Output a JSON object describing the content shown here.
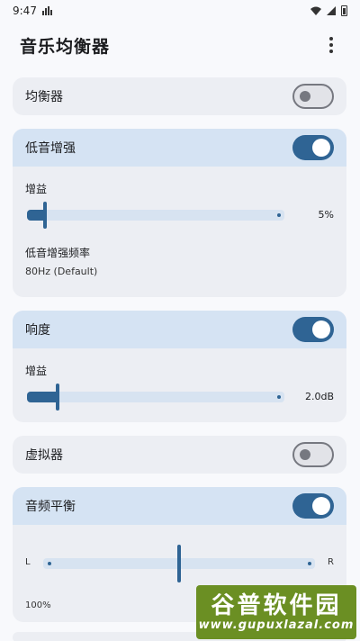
{
  "status_bar": {
    "time": "9:47"
  },
  "app_bar": {
    "title": "音乐均衡器"
  },
  "equalizer": {
    "label": "均衡器",
    "enabled": false
  },
  "bass_boost": {
    "label": "低音增强",
    "enabled": true,
    "gain_label": "增益",
    "gain_value": "5%",
    "gain_fraction": 0.05,
    "freq_label": "低音增强频率",
    "freq_value": "80Hz (Default)"
  },
  "loudness": {
    "label": "响度",
    "enabled": true,
    "gain_label": "增益",
    "gain_value": "2.0dB",
    "gain_fraction": 0.12
  },
  "virtualizer": {
    "label": "虚拟器",
    "enabled": false
  },
  "balance": {
    "label": "音频平衡",
    "enabled": true,
    "left_label": "L",
    "right_label": "R",
    "value": "100%",
    "position_fraction": 0.5
  },
  "watermark": {
    "text": "谷普软件园",
    "url": "www.gupuxlazal.com"
  },
  "colors": {
    "accent": "#2f6494",
    "active_header": "#d5e3f3",
    "card_bg": "#eceef3"
  }
}
